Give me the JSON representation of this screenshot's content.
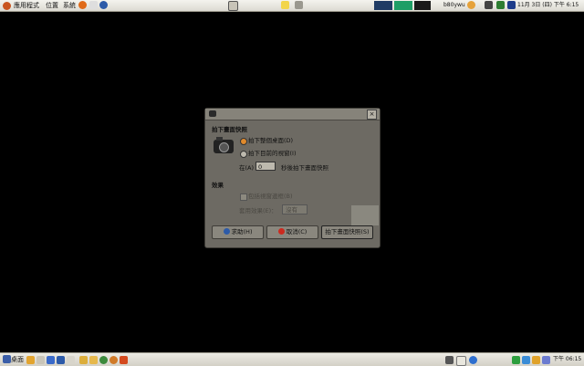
{
  "top_panel": {
    "menus": [
      "應用程式",
      "位置",
      "系統"
    ],
    "username": "b80ywu",
    "clock": "11月 3日 (四) 下午 6:15"
  },
  "dialog": {
    "section_title": "拍下畫面快照",
    "option_desktop": "拍下整個桌面(D)",
    "option_window": "拍下目前的視窗(I)",
    "delay_prefix": "在(A)",
    "delay_value": "0",
    "delay_suffix": "秒後拍下畫面快照",
    "effects_title": "效果",
    "effects_checkbox": "包括視窗邊框(B)",
    "apply_effect_label": "套用效果(E)：",
    "apply_effect_value": "沒有",
    "help_button": "求助(H)",
    "cancel_button": "取消(C)",
    "take_button": "拍下畫面快照(S)"
  },
  "bottom_panel": {
    "desktop_button": "桌面",
    "clock": "下午 06:15"
  }
}
